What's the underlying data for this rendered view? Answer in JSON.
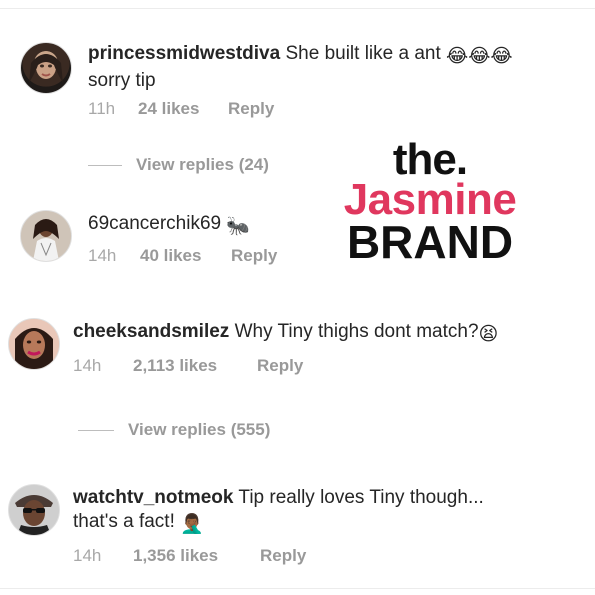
{
  "comments": [
    {
      "username": "princessmidwestdiva",
      "text": "She built like a ant",
      "emoji": "😂😂😂",
      "text2": "sorry tip",
      "time": "11h",
      "likes": "24 likes",
      "reply": "Reply",
      "view_replies": "View replies (24)",
      "avatar_icon": "avatar-woman-icon"
    },
    {
      "username": "69cancerchik69",
      "text": "",
      "emoji": "🐜",
      "time": "14h",
      "likes": "40 likes",
      "reply": "Reply",
      "avatar_icon": "avatar-woman-icon"
    },
    {
      "username": "cheeksandsmilez",
      "text": "Why Tiny thighs dont match?",
      "emoji": "😫",
      "time": "14h",
      "likes": "2,113 likes",
      "reply": "Reply",
      "view_replies": "View replies (555)",
      "avatar_icon": "avatar-woman-icon"
    },
    {
      "username": "watchtv_notmeok",
      "text": "Tip really loves Tiny though...",
      "text2": "that's a fact!",
      "emoji": "🤦🏾‍♂️",
      "time": "14h",
      "likes": "1,356 likes",
      "reply": "Reply",
      "avatar_icon": "avatar-man-icon"
    }
  ],
  "watermark": {
    "line1": "the.",
    "line2": "Jasmine",
    "line3": "BRAND"
  },
  "colors": {
    "text": "#262626",
    "meta": "#999999",
    "brand_pink": "#e0375e"
  }
}
